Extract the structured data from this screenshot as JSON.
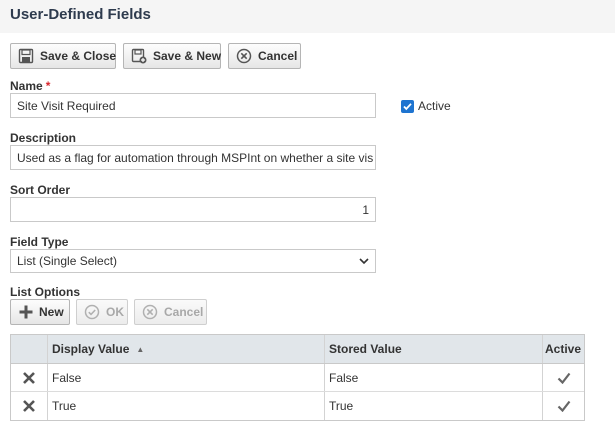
{
  "header": {
    "title": "User-Defined Fields"
  },
  "toolbar": {
    "save_close_label": "Save & Close",
    "save_new_label": "Save & New",
    "cancel_label": "Cancel"
  },
  "form": {
    "name": {
      "label": "Name",
      "required_mark": "*",
      "value": "Site Visit Required"
    },
    "active": {
      "label": "Active",
      "checked": true
    },
    "description": {
      "label": "Description",
      "value": "Used as a flag for automation through MSPInt on whether a site vis"
    },
    "sort_order": {
      "label": "Sort Order",
      "value": "1"
    },
    "field_type": {
      "label": "Field Type",
      "value": "List (Single Select)"
    }
  },
  "list_options": {
    "label": "List Options",
    "new_label": "New",
    "ok_label": "OK",
    "cancel_label": "Cancel",
    "columns": [
      "",
      "Display Value",
      "Stored Value",
      "Active"
    ],
    "rows": [
      {
        "display": "False",
        "stored": "False",
        "active": true
      },
      {
        "display": "True",
        "stored": "True",
        "active": true
      }
    ]
  },
  "colors": {
    "title": "#2e3b4e",
    "required": "#d9262c",
    "checkbox": "#1e74d0",
    "grid_header": "#e1e6ea"
  },
  "icons": [
    "save-icon",
    "save-new-icon",
    "cancel-icon",
    "plus-icon",
    "ok-icon",
    "chevron-down-icon",
    "delete-icon",
    "checkmark-icon",
    "sort-ascending-icon"
  ]
}
